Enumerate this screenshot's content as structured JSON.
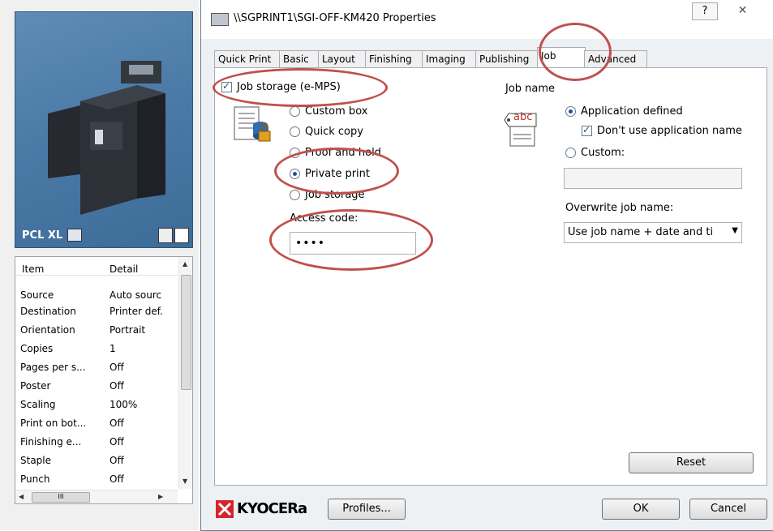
{
  "window": {
    "title": "\\\\SGPRINT1\\SGI-OFF-KM420 Properties",
    "help_label": "?",
    "close_label": "✕"
  },
  "left_panel": {
    "pdl_label": "PCL XL",
    "table_header": {
      "item": "Item",
      "detail": "Detail"
    },
    "rows": [
      {
        "item": "Source",
        "detail": "Auto sourc"
      },
      {
        "item": "Destination",
        "detail": "Printer def."
      },
      {
        "item": "Orientation",
        "detail": "Portrait"
      },
      {
        "item": "Copies",
        "detail": "1"
      },
      {
        "item": "Pages per s...",
        "detail": "Off"
      },
      {
        "item": "Poster",
        "detail": "Off"
      },
      {
        "item": "Scaling",
        "detail": "100%"
      },
      {
        "item": "Print on bot...",
        "detail": "Off"
      },
      {
        "item": "Finishing e...",
        "detail": "Off"
      },
      {
        "item": "Staple",
        "detail": "Off"
      },
      {
        "item": "Punch",
        "detail": "Off"
      }
    ],
    "hscroll_thumb": "III"
  },
  "tabs": [
    "Quick Print",
    "Basic",
    "Layout",
    "Finishing",
    "Imaging",
    "Publishing",
    "Job",
    "Advanced"
  ],
  "active_tab": "Job",
  "job_storage": {
    "checkbox_label": "Job storage (e-MPS)",
    "checked": true,
    "options": [
      "Custom box",
      "Quick copy",
      "Proof and hold",
      "Private print",
      "Job storage"
    ],
    "selected": "Private print",
    "access_code_label": "Access code:",
    "access_code_value": "••••"
  },
  "job_name": {
    "heading": "Job name",
    "icon_text": "abc",
    "app_defined_label": "Application defined",
    "dont_use_app_name_label": "Don't use application name",
    "dont_use_checked": true,
    "custom_label": "Custom:",
    "custom_value": "",
    "overwrite_label": "Overwrite job name:",
    "overwrite_value": "Use job name + date and ti"
  },
  "buttons": {
    "reset": "Reset",
    "profiles": "Profiles...",
    "ok": "OK",
    "cancel": "Cancel"
  },
  "brand": {
    "name": "KYOCERa",
    "color": "#d7232b"
  },
  "accent_colors": {
    "annotation": "#c0504d",
    "selection": "#1e4f9c"
  }
}
